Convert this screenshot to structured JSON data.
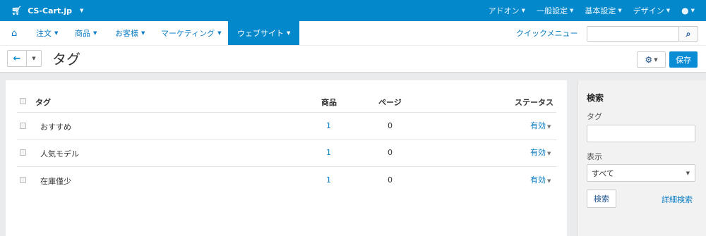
{
  "topbar": {
    "brand": "CS-Cart.jp",
    "menu": [
      {
        "label": "アドオン"
      },
      {
        "label": "一般設定"
      },
      {
        "label": "基本設定"
      },
      {
        "label": "デザイン"
      }
    ]
  },
  "nav": {
    "items": [
      {
        "label": "注文"
      },
      {
        "label": "商品"
      },
      {
        "label": "お客様"
      },
      {
        "label": "マーケティング"
      },
      {
        "label": "ウェブサイト",
        "active": true
      }
    ],
    "quick_menu": "クイックメニュー",
    "search_value": ""
  },
  "title": {
    "text": "タグ",
    "save_label": "保存"
  },
  "table": {
    "headers": {
      "tag": "タグ",
      "products": "商品",
      "pages": "ページ",
      "status": "ステータス"
    },
    "rows": [
      {
        "tag": "おすすめ",
        "products": "1",
        "pages": "0",
        "status": "有効"
      },
      {
        "tag": "人気モデル",
        "products": "1",
        "pages": "0",
        "status": "有効"
      },
      {
        "tag": "在庫僅少",
        "products": "1",
        "pages": "0",
        "status": "有効"
      }
    ]
  },
  "sidebar": {
    "heading": "検索",
    "tag_label": "タグ",
    "tag_value": "",
    "display_label": "表示",
    "display_value": "すべて",
    "search_button": "検索",
    "advanced_link": "詳細検索"
  },
  "colors": {
    "topbar": "#0388cc",
    "link": "#0b7dc4",
    "save": "#0b8dd6"
  }
}
